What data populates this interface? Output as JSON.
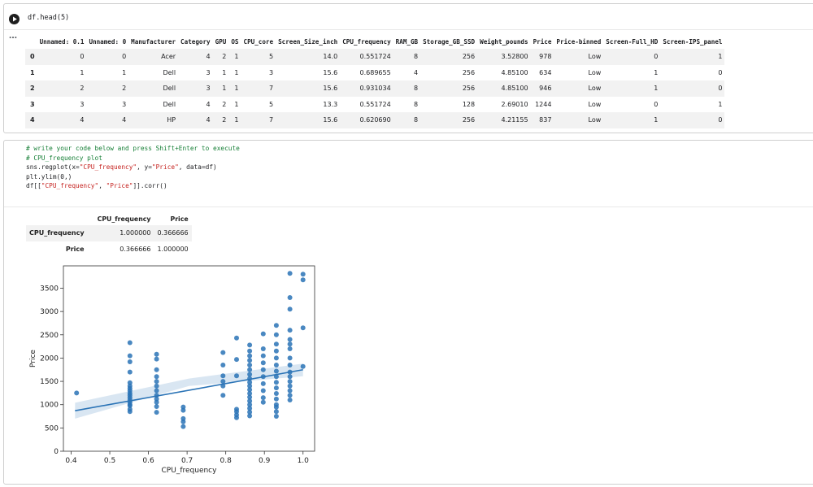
{
  "cell1": {
    "code": "df.head(5)",
    "output_menu": "…",
    "table": {
      "columns": [
        "",
        "Unnamed: 0.1",
        "Unnamed: 0",
        "Manufacturer",
        "Category",
        "GPU",
        "OS",
        "CPU_core",
        "Screen_Size_inch",
        "CPU_frequency",
        "RAM_GB",
        "Storage_GB_SSD",
        "Weight_pounds",
        "Price",
        "Price-binned",
        "Screen-Full_HD",
        "Screen-IPS_panel"
      ],
      "rows": [
        [
          "0",
          "0",
          "0",
          "Acer",
          "4",
          "2",
          "1",
          "5",
          "14.0",
          "0.551724",
          "8",
          "256",
          "3.52800",
          "978",
          "Low",
          "0",
          "1"
        ],
        [
          "1",
          "1",
          "1",
          "Dell",
          "3",
          "1",
          "1",
          "3",
          "15.6",
          "0.689655",
          "4",
          "256",
          "4.85100",
          "634",
          "Low",
          "1",
          "0"
        ],
        [
          "2",
          "2",
          "2",
          "Dell",
          "3",
          "1",
          "1",
          "7",
          "15.6",
          "0.931034",
          "8",
          "256",
          "4.85100",
          "946",
          "Low",
          "1",
          "0"
        ],
        [
          "3",
          "3",
          "3",
          "Dell",
          "4",
          "2",
          "1",
          "5",
          "13.3",
          "0.551724",
          "8",
          "128",
          "2.69010",
          "1244",
          "Low",
          "0",
          "1"
        ],
        [
          "4",
          "4",
          "4",
          "HP",
          "4",
          "2",
          "1",
          "7",
          "15.6",
          "0.620690",
          "8",
          "256",
          "4.21155",
          "837",
          "Low",
          "1",
          "0"
        ]
      ]
    }
  },
  "cell2": {
    "code_lines": [
      {
        "type": "comment",
        "text": "# write your code below and press Shift+Enter to execute"
      },
      {
        "type": "comment",
        "text": "# CPU_frequency plot"
      },
      {
        "type": "code",
        "parts": [
          {
            "t": "sns.regplot(x="
          },
          {
            "t": "\"CPU_frequency\"",
            "s": true
          },
          {
            "t": ", y="
          },
          {
            "t": "\"Price\"",
            "s": true
          },
          {
            "t": ", data=df)"
          }
        ]
      },
      {
        "type": "code",
        "parts": [
          {
            "t": "plt.ylim(0,)"
          }
        ]
      },
      {
        "type": "code",
        "parts": [
          {
            "t": "df[["
          },
          {
            "t": "\"CPU_frequency\"",
            "s": true
          },
          {
            "t": ", "
          },
          {
            "t": "\"Price\"",
            "s": true
          },
          {
            "t": "]].corr()"
          }
        ]
      }
    ],
    "corr_table": {
      "columns": [
        "",
        "CPU_frequency",
        "Price"
      ],
      "rows": [
        [
          "CPU_frequency",
          "1.000000",
          "0.366666"
        ],
        [
          "Price",
          "0.366666",
          "1.000000"
        ]
      ]
    }
  },
  "chart_data": {
    "type": "scatter",
    "xlabel": "CPU_frequency",
    "ylabel": "Price",
    "xlim": [
      0.38,
      1.03
    ],
    "ylim": [
      0,
      3980
    ],
    "xticks": [
      0.4,
      0.5,
      0.6,
      0.7,
      0.8,
      0.9,
      1.0
    ],
    "xtick_labels": [
      "0.4",
      "0.5",
      "0.6",
      "0.7",
      "0.8",
      "0.9",
      "1.0"
    ],
    "yticks": [
      0,
      500,
      1000,
      1500,
      2000,
      2500,
      3000,
      3500
    ],
    "ytick_labels": [
      "0",
      "500",
      "1000",
      "1500",
      "2000",
      "2500",
      "3000",
      "3500"
    ],
    "color": "#2a73b6",
    "regression": {
      "x": [
        0.41,
        1.0
      ],
      "y": [
        870,
        1750
      ],
      "ci_upper": [
        1040,
        1880
      ],
      "ci_mid_upper": 1560,
      "ci_mid_lower": 1400,
      "ci_lower": [
        700,
        1610
      ]
    },
    "points": [
      {
        "x": 0.414,
        "y": 1250
      },
      {
        "x": 0.552,
        "y": 2330
      },
      {
        "x": 0.552,
        "y": 2050
      },
      {
        "x": 0.552,
        "y": 1920
      },
      {
        "x": 0.552,
        "y": 1700
      },
      {
        "x": 0.552,
        "y": 1470
      },
      {
        "x": 0.552,
        "y": 1400
      },
      {
        "x": 0.552,
        "y": 1350
      },
      {
        "x": 0.552,
        "y": 1300
      },
      {
        "x": 0.552,
        "y": 1244
      },
      {
        "x": 0.552,
        "y": 1200
      },
      {
        "x": 0.552,
        "y": 1150
      },
      {
        "x": 0.552,
        "y": 1100
      },
      {
        "x": 0.552,
        "y": 1050
      },
      {
        "x": 0.552,
        "y": 1000
      },
      {
        "x": 0.552,
        "y": 978
      },
      {
        "x": 0.552,
        "y": 900
      },
      {
        "x": 0.552,
        "y": 850
      },
      {
        "x": 0.621,
        "y": 2080
      },
      {
        "x": 0.621,
        "y": 1980
      },
      {
        "x": 0.621,
        "y": 1750
      },
      {
        "x": 0.621,
        "y": 1600
      },
      {
        "x": 0.621,
        "y": 1500
      },
      {
        "x": 0.621,
        "y": 1400
      },
      {
        "x": 0.621,
        "y": 1300
      },
      {
        "x": 0.621,
        "y": 1200
      },
      {
        "x": 0.621,
        "y": 1120
      },
      {
        "x": 0.621,
        "y": 1050
      },
      {
        "x": 0.621,
        "y": 960
      },
      {
        "x": 0.621,
        "y": 837
      },
      {
        "x": 0.69,
        "y": 950
      },
      {
        "x": 0.69,
        "y": 880
      },
      {
        "x": 0.69,
        "y": 700
      },
      {
        "x": 0.69,
        "y": 634
      },
      {
        "x": 0.69,
        "y": 530
      },
      {
        "x": 0.793,
        "y": 2120
      },
      {
        "x": 0.793,
        "y": 1850
      },
      {
        "x": 0.793,
        "y": 1620
      },
      {
        "x": 0.793,
        "y": 1500
      },
      {
        "x": 0.793,
        "y": 1400
      },
      {
        "x": 0.793,
        "y": 1200
      },
      {
        "x": 0.828,
        "y": 2430
      },
      {
        "x": 0.828,
        "y": 1970
      },
      {
        "x": 0.828,
        "y": 1620
      },
      {
        "x": 0.828,
        "y": 900
      },
      {
        "x": 0.828,
        "y": 850
      },
      {
        "x": 0.828,
        "y": 780
      },
      {
        "x": 0.828,
        "y": 720
      },
      {
        "x": 0.862,
        "y": 2280
      },
      {
        "x": 0.862,
        "y": 2150
      },
      {
        "x": 0.862,
        "y": 2050
      },
      {
        "x": 0.862,
        "y": 1950
      },
      {
        "x": 0.862,
        "y": 1850
      },
      {
        "x": 0.862,
        "y": 1750
      },
      {
        "x": 0.862,
        "y": 1650
      },
      {
        "x": 0.862,
        "y": 1560
      },
      {
        "x": 0.862,
        "y": 1480
      },
      {
        "x": 0.862,
        "y": 1400
      },
      {
        "x": 0.862,
        "y": 1320
      },
      {
        "x": 0.862,
        "y": 1240
      },
      {
        "x": 0.862,
        "y": 1160
      },
      {
        "x": 0.862,
        "y": 1080
      },
      {
        "x": 0.862,
        "y": 1000
      },
      {
        "x": 0.862,
        "y": 920
      },
      {
        "x": 0.862,
        "y": 840
      },
      {
        "x": 0.862,
        "y": 760
      },
      {
        "x": 0.897,
        "y": 2520
      },
      {
        "x": 0.897,
        "y": 2200
      },
      {
        "x": 0.897,
        "y": 2050
      },
      {
        "x": 0.897,
        "y": 1900
      },
      {
        "x": 0.897,
        "y": 1750
      },
      {
        "x": 0.897,
        "y": 1600
      },
      {
        "x": 0.897,
        "y": 1450
      },
      {
        "x": 0.897,
        "y": 1300
      },
      {
        "x": 0.897,
        "y": 1150
      },
      {
        "x": 0.897,
        "y": 1050
      },
      {
        "x": 0.931,
        "y": 2700
      },
      {
        "x": 0.931,
        "y": 2500
      },
      {
        "x": 0.931,
        "y": 2300
      },
      {
        "x": 0.931,
        "y": 2150
      },
      {
        "x": 0.931,
        "y": 2000
      },
      {
        "x": 0.931,
        "y": 1850
      },
      {
        "x": 0.931,
        "y": 1720
      },
      {
        "x": 0.931,
        "y": 1600
      },
      {
        "x": 0.931,
        "y": 1480
      },
      {
        "x": 0.931,
        "y": 1360
      },
      {
        "x": 0.931,
        "y": 1240
      },
      {
        "x": 0.931,
        "y": 1120
      },
      {
        "x": 0.931,
        "y": 1000
      },
      {
        "x": 0.931,
        "y": 946
      },
      {
        "x": 0.931,
        "y": 850
      },
      {
        "x": 0.931,
        "y": 750
      },
      {
        "x": 0.966,
        "y": 3820
      },
      {
        "x": 0.966,
        "y": 3300
      },
      {
        "x": 0.966,
        "y": 3050
      },
      {
        "x": 0.966,
        "y": 2600
      },
      {
        "x": 0.966,
        "y": 2400
      },
      {
        "x": 0.966,
        "y": 2300
      },
      {
        "x": 0.966,
        "y": 2200
      },
      {
        "x": 0.966,
        "y": 2000
      },
      {
        "x": 0.966,
        "y": 1850
      },
      {
        "x": 0.966,
        "y": 1700
      },
      {
        "x": 0.966,
        "y": 1600
      },
      {
        "x": 0.966,
        "y": 1500
      },
      {
        "x": 0.966,
        "y": 1400
      },
      {
        "x": 0.966,
        "y": 1300
      },
      {
        "x": 0.966,
        "y": 1200
      },
      {
        "x": 0.966,
        "y": 1100
      },
      {
        "x": 1.0,
        "y": 3800
      },
      {
        "x": 1.0,
        "y": 3680
      },
      {
        "x": 1.0,
        "y": 2650
      },
      {
        "x": 1.0,
        "y": 1820
      }
    ]
  }
}
